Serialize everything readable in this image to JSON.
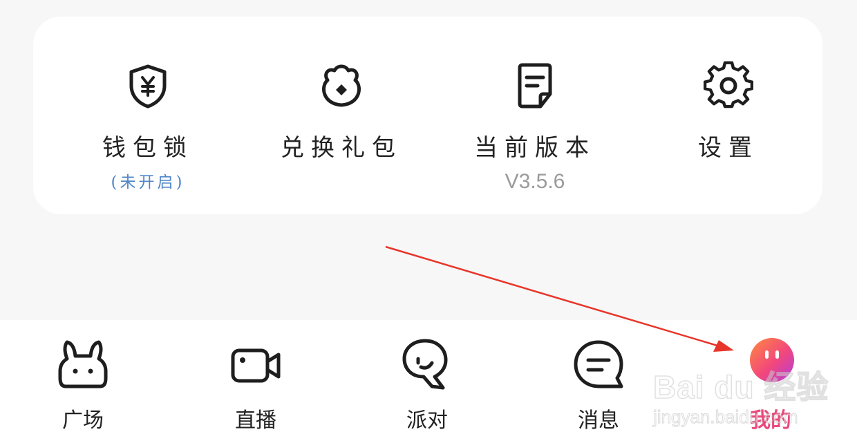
{
  "menu": {
    "items": [
      {
        "label": "钱包锁",
        "sub": "(未开启)",
        "icon": "shield-yuan-icon"
      },
      {
        "label": "兑换礼包",
        "icon": "gift-bag-icon"
      },
      {
        "label": "当前版本",
        "version": "V3.5.6",
        "icon": "document-icon"
      },
      {
        "label": "设置",
        "icon": "gear-icon"
      }
    ],
    "sub_color": "#4f86c9"
  },
  "tabbar": {
    "tabs": [
      {
        "label": "广场",
        "icon": "rabbit-icon"
      },
      {
        "label": "直播",
        "icon": "video-camera-icon"
      },
      {
        "label": "派对",
        "icon": "party-icon"
      },
      {
        "label": "消息",
        "icon": "chat-bubble-icon"
      },
      {
        "label": "我的",
        "icon": "profile-avatar-icon",
        "active": true
      }
    ],
    "active_color": "#e94a7d"
  },
  "annotation": {
    "arrow_color": "#e8352a"
  },
  "watermark": {
    "main": "Bai du 经验",
    "sub": "jingyan.baidu.com"
  }
}
